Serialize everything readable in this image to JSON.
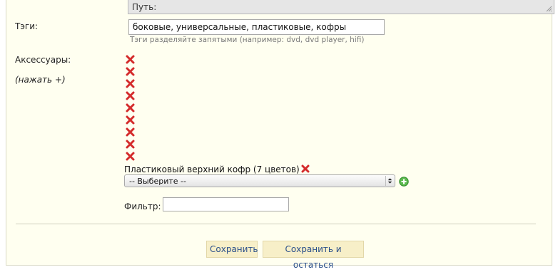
{
  "path": {
    "label": "Путь:"
  },
  "tags": {
    "label": "Тэги:",
    "value": "боковые, универсальные, пластиковые, кофры",
    "hint": "Тэги разделяйте запятыми (например: dvd, dvd player, hifi)"
  },
  "accessories": {
    "label": "Аксессуары:",
    "hint": "(нажать +)",
    "empty_item_count": 9,
    "item_label": "Пластиковый верхний кофр (7 цветов)",
    "select_value": "-- Выберите --",
    "icons": {
      "remove": "remove-icon",
      "add": "add-icon"
    }
  },
  "filter": {
    "label": "Фильтр:",
    "value": ""
  },
  "buttons": {
    "save": "Сохранить",
    "save_and_stay": "Сохранить и остаться"
  },
  "colors": {
    "panel_bg": "#fffff0",
    "button_bg": "#f7efc8",
    "button_text": "#2a4f8a",
    "remove_red": "#d42b2b",
    "add_green": "#3fa53a"
  }
}
